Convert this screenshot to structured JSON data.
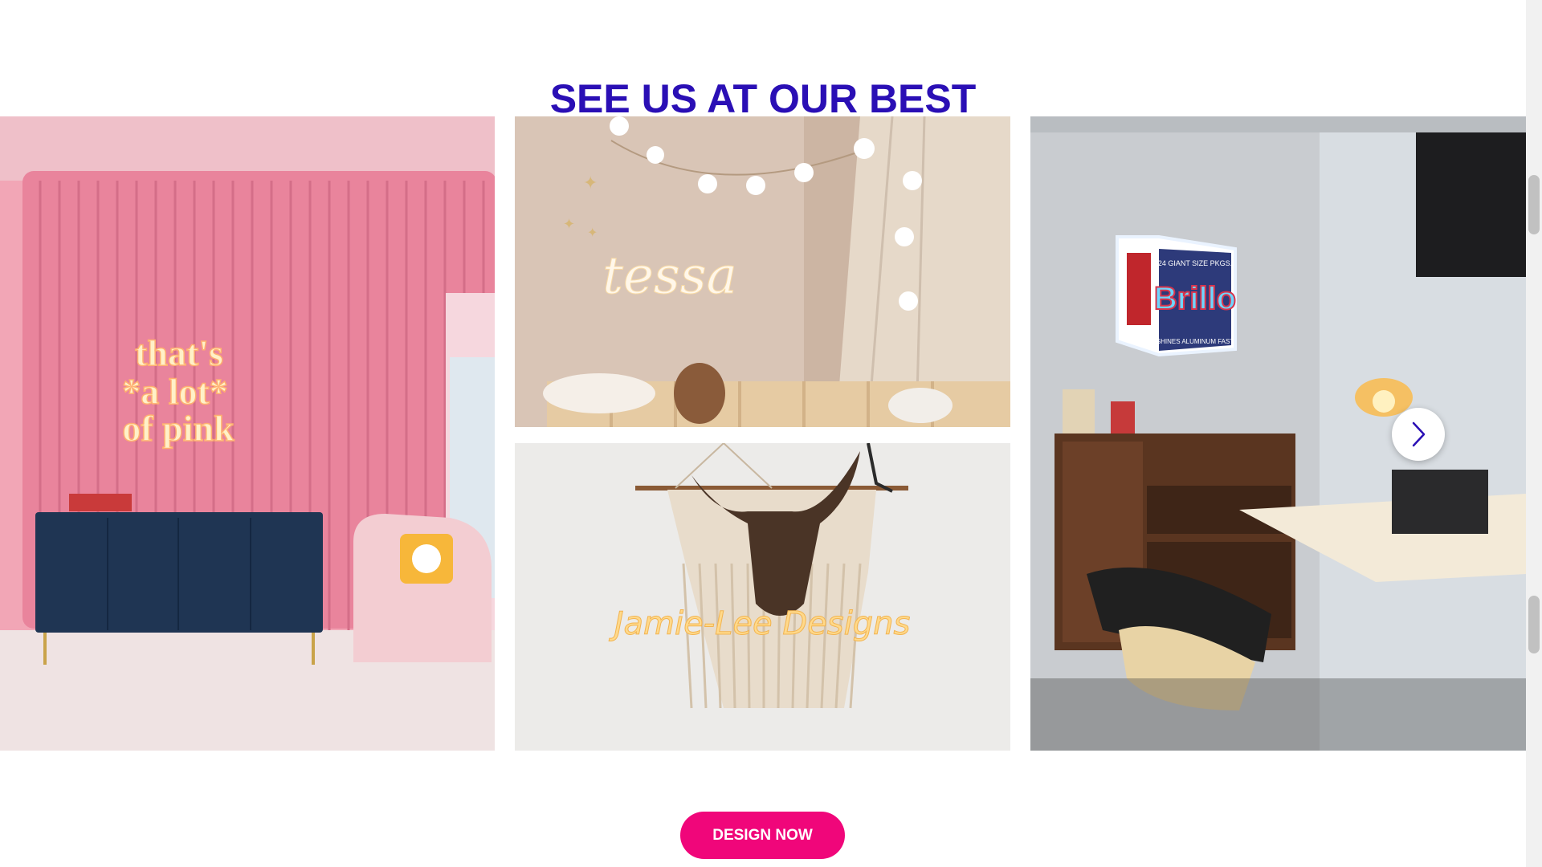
{
  "section": {
    "heading": "SEE US AT OUR BEST"
  },
  "gallery": {
    "images": [
      {
        "id": "left",
        "sign_text_lines": [
          "that's",
          "*a lot*",
          "of pink"
        ]
      },
      {
        "id": "mid-top",
        "sign_text": "tessa"
      },
      {
        "id": "mid-bottom",
        "sign_text": "Jamie-Lee Designs"
      },
      {
        "id": "right",
        "sign_text_top": "24 GIANT SIZE PKGS.",
        "sign_text_main": "Brillo",
        "sign_text_bottom": "SHINES ALUMINUM FAST"
      }
    ],
    "next_icon": "chevron-right-icon"
  },
  "cta": {
    "label": "DESIGN NOW"
  },
  "colors": {
    "heading": "#2a0fb5",
    "cta": "#f0067a"
  }
}
